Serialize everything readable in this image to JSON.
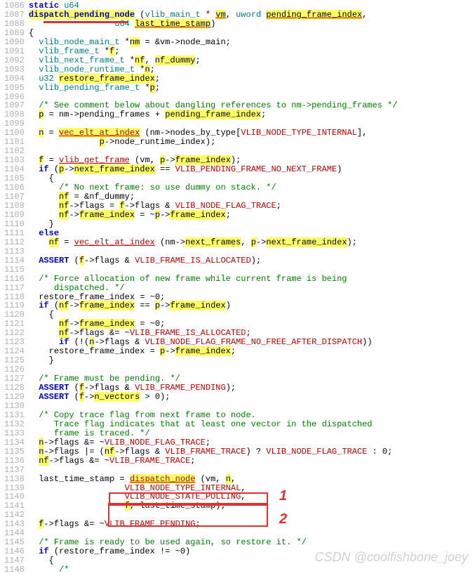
{
  "watermark": "CSDN @coolfishbone_joey",
  "annotations": {
    "mark1": "1",
    "mark2": "2"
  },
  "lines": [
    {
      "n": 1086,
      "t": "<span class='kw'>static</span> <span class='typ'>u64</span>"
    },
    {
      "n": 1087,
      "t": "<span class='kw hl'>dispatch_pending_node</span> (<span class='typ'>vlib_main_t</span> * <span class='hl ul'>vm</span>, <span class='typ'>uword</span> <span class='hl ul'>pending_frame_index</span>,"
    },
    {
      "n": 1088,
      "t": "                 <span class='typ'>u64</span> <span class='hl ul'>last_time_stamp</span>)"
    },
    {
      "n": 1089,
      "t": "{"
    },
    {
      "n": 1090,
      "t": "  <span class='typ'>vlib_node_main_t</span> *<span class='hl'>nm</span> = &amp;vm-&gt;node_main;"
    },
    {
      "n": 1091,
      "t": "  <span class='typ'>vlib_frame_t</span> *<span class='hl'>f</span>;"
    },
    {
      "n": 1092,
      "t": "  <span class='typ'>vlib_next_frame_t</span> *<span class='hl'>nf</span>, <span class='hl'>nf_dummy</span>;"
    },
    {
      "n": 1093,
      "t": "  <span class='typ'>vlib_node_runtime_t</span> *<span class='hl'>n</span>;"
    },
    {
      "n": 1094,
      "t": "  <span class='typ'>u32</span> <span class='hl'>restore_frame_index</span>;"
    },
    {
      "n": 1095,
      "t": "  <span class='typ'>vlib_pending_frame_t</span> *<span class='hl'>p</span>;"
    },
    {
      "n": 1096,
      "t": ""
    },
    {
      "n": 1097,
      "t": "  <span class='com'>/* See comment below about dangling references to nm-&gt;pending_frames */</span>"
    },
    {
      "n": 1098,
      "t": "  <span class='hl'>p</span> = nm-&gt;pending_frames + <span class='hl'>pending_frame_index</span>;"
    },
    {
      "n": 1099,
      "t": ""
    },
    {
      "n": 1100,
      "t": "  <span class='hl'>n</span> = <span class='hl redul'>vec_elt_at_index</span> (nm-&gt;nodes_by_type[<span class='red'>VLIB_NODE_TYPE_INTERNAL</span>],"
    },
    {
      "n": 1101,
      "t": "              <span class='hl'>p</span>-&gt;node_runtime_index);"
    },
    {
      "n": 1102,
      "t": ""
    },
    {
      "n": 1103,
      "t": "  <span class='hl'>f</span> = <span class='redul'>vlib_get_frame</span> (vm, <span class='hl'>p</span>-&gt;<span class='hl'>frame_index</span>);"
    },
    {
      "n": 1104,
      "t": "  <span class='kw'>if</span> (<span class='hl'>p</span>-&gt;<span class='hl'>next_frame_index</span> == <span class='red'>VLIB_PENDING_FRAME_NO_NEXT_FRAME</span>)"
    },
    {
      "n": 1105,
      "t": "    {"
    },
    {
      "n": 1106,
      "t": "      <span class='com'>/* No next frame: so use dummy on stack. */</span>"
    },
    {
      "n": 1107,
      "t": "      <span class='hl'>nf</span> = &amp;nf_dummy;"
    },
    {
      "n": 1108,
      "t": "      <span class='hl'>nf</span>-&gt;flags = <span class='hl'>f</span>-&gt;flags &amp; <span class='red'>VLIB_NODE_FLAG_TRACE</span>;"
    },
    {
      "n": 1109,
      "t": "      <span class='hl'>nf</span>-&gt;<span class='hl'>frame_index</span> = ~<span class='hl'>p</span>-&gt;<span class='hl'>frame_index</span>;"
    },
    {
      "n": 1110,
      "t": "    }"
    },
    {
      "n": 1111,
      "t": "  <span class='kw'>else</span>"
    },
    {
      "n": 1112,
      "t": "    <span class='hl'>nf</span> = <span class='redul'>vec_elt_at_index</span> (nm-&gt;<span class='hl'>next_frames</span>, <span class='hl'>p</span>-&gt;<span class='hl'>next_frame_index</span>);"
    },
    {
      "n": 1113,
      "t": ""
    },
    {
      "n": 1114,
      "t": "  <span class='kw'>ASSERT</span> (<span class='hl'>f</span>-&gt;flags &amp; <span class='red'>VLIB_FRAME_IS_ALLOCATED</span>);"
    },
    {
      "n": 1115,
      "t": ""
    },
    {
      "n": 1116,
      "t": "  <span class='com'>/* Force allocation of new frame while current frame is being</span>"
    },
    {
      "n": 1117,
      "t": "<span class='com'>     dispatched. */</span>"
    },
    {
      "n": 1118,
      "t": "  restore_frame_index = ~0;"
    },
    {
      "n": 1119,
      "t": "  <span class='kw'>if</span> (<span class='hl'>nf</span>-&gt;<span class='hl'>frame_index</span> == <span class='hl'>p</span>-&gt;<span class='hl'>frame_index</span>)"
    },
    {
      "n": 1120,
      "t": "    {"
    },
    {
      "n": 1121,
      "t": "      <span class='hl'>nf</span>-&gt;<span class='hl'>frame_index</span> = ~0;"
    },
    {
      "n": 1122,
      "t": "      <span class='hl'>nf</span>-&gt;flags &amp;= ~<span class='red'>VLIB_FRAME_IS_ALLOCATED</span>;"
    },
    {
      "n": 1123,
      "t": "      <span class='kw'>if</span> (!(<span class='hl'>n</span>-&gt;flags &amp; <span class='red'>VLIB_NODE_FLAG_FRAME_NO_FREE_AFTER_DISPATCH</span>))"
    },
    {
      "n": 1124,
      "t": "    restore_frame_index = <span class='hl'>p</span>-&gt;<span class='hl'>frame_index</span>;"
    },
    {
      "n": 1125,
      "t": "    }"
    },
    {
      "n": 1126,
      "t": ""
    },
    {
      "n": 1127,
      "t": "  <span class='com'>/* Frame must be pending. */</span>"
    },
    {
      "n": 1128,
      "t": "  <span class='kw'>ASSERT</span> (<span class='hl'>f</span>-&gt;flags &amp; <span class='red'>VLIB_FRAME_PENDING</span>);"
    },
    {
      "n": 1129,
      "t": "  <span class='kw'>ASSERT</span> (<span class='hl'>f</span>-&gt;<span class='hl'>n_vectors</span> &gt; 0);"
    },
    {
      "n": 1130,
      "t": ""
    },
    {
      "n": 1131,
      "t": "  <span class='com'>/* Copy trace flag from next frame to node.</span>"
    },
    {
      "n": 1132,
      "t": "<span class='com'>     Trace flag indicates that at least one vector in the dispatched</span>"
    },
    {
      "n": 1133,
      "t": "<span class='com'>     frame is traced. */</span>"
    },
    {
      "n": 1134,
      "t": "  <span class='hl'>n</span>-&gt;flags &amp;= ~<span class='red'>VLIB_NODE_FLAG_TRACE</span>;"
    },
    {
      "n": 1135,
      "t": "  <span class='hl'>n</span>-&gt;flags |= (<span class='hl'>nf</span>-&gt;flags &amp; <span class='red'>VLIB_FRAME_TRACE</span>) ? <span class='red'>VLIB_NODE_FLAG_TRACE</span> : 0;"
    },
    {
      "n": 1136,
      "t": "  <span class='hl'>nf</span>-&gt;flags &amp;= ~<span class='red'>VLIB_FRAME_TRACE</span>;"
    },
    {
      "n": 1137,
      "t": ""
    },
    {
      "n": 1138,
      "t": "  last_time_stamp = <span class='redul hl'>dispatch_node</span> (vm, <span class='hl'>n</span>,"
    },
    {
      "n": 1139,
      "t": "                   <span class='red'>VLIB_NODE_TYPE_INTERNAL</span>,"
    },
    {
      "n": 1140,
      "t": "                   <span class='red'>VLIB_NODE_STATE_POLLING</span>,"
    },
    {
      "n": 1141,
      "t": "                   <span class='hl'>f</span>, last_time_stamp);"
    },
    {
      "n": 1142,
      "t": ""
    },
    {
      "n": 1143,
      "t": "  <span class='hl'>f</span>-&gt;flags &amp;= ~<span class='red'>VLIB_FRAME_PENDING</span>;"
    },
    {
      "n": 1144,
      "t": ""
    },
    {
      "n": 1145,
      "t": "  <span class='com'>/* Frame is ready to be used again, so restore it. */</span>"
    },
    {
      "n": 1146,
      "t": "  <span class='kw'>if</span> (restore_frame_index != ~0)"
    },
    {
      "n": 1147,
      "t": "    {"
    },
    {
      "n": 1148,
      "t": "      <span class='com'>/*</span>"
    }
  ]
}
